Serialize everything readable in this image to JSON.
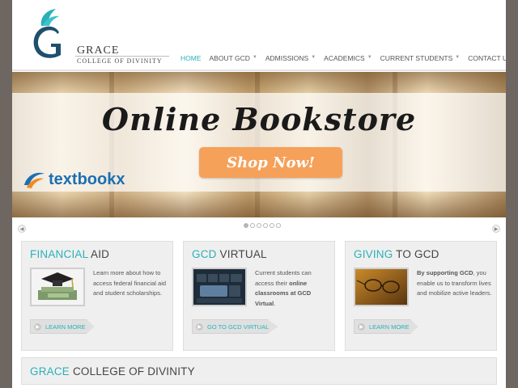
{
  "logo": {
    "name": "GRACE",
    "subtitle": "COLLEGE OF DIVINITY"
  },
  "nav": [
    {
      "label": "HOME",
      "active": true,
      "dropdown": false
    },
    {
      "label": "ABOUT GCD",
      "active": false,
      "dropdown": true
    },
    {
      "label": "ADMISSIONS",
      "active": false,
      "dropdown": true
    },
    {
      "label": "ACADEMICS",
      "active": false,
      "dropdown": true
    },
    {
      "label": "CURRENT STUDENTS",
      "active": false,
      "dropdown": true
    },
    {
      "label": "CONTACT US",
      "active": false,
      "dropdown": false
    }
  ],
  "hero": {
    "title": "Online Bookstore",
    "button": "Shop Now!",
    "partner": "textbookx"
  },
  "slider": {
    "slide_count": 6,
    "active_index": 0
  },
  "boxes": [
    {
      "title_accent": "FINANCIAL",
      "title_rest": " AID",
      "desc_bold": "",
      "desc": "Learn more about how to access federal financial aid and student scholarships.",
      "button": "LEARN MORE"
    },
    {
      "title_accent": "GCD",
      "title_rest": " VIRTUAL",
      "desc_pre": "Current students can access their ",
      "desc_bold": "online classrooms at GCD Virtual",
      "desc_post": ".",
      "button": "GO TO GCD VIRTUAL"
    },
    {
      "title_accent": "GIVING",
      "title_rest": " TO GCD",
      "desc_bold": "By supporting GCD",
      "desc_post": ", you enable us to transform lives and mobilize active leaders.",
      "button": "LEARN MORE"
    }
  ],
  "footer": {
    "title_accent": "GRACE",
    "title_rest": " COLLEGE OF DIVINITY"
  },
  "colors": {
    "accent": "#2ab0b8",
    "button_orange": "#f5a15a",
    "textbookx_blue": "#1b6fb3",
    "frame": "#6e6660"
  }
}
